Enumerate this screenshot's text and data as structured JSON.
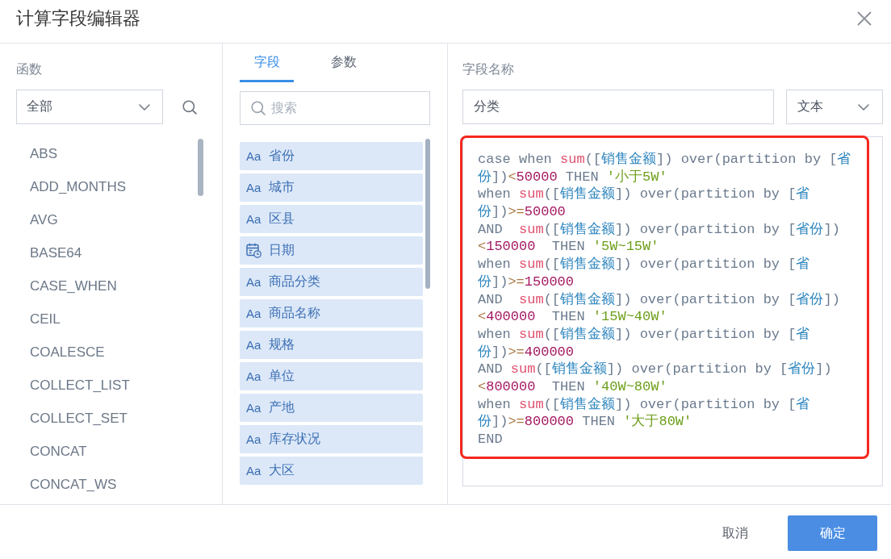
{
  "dialog": {
    "title": "计算字段编辑器"
  },
  "functions_panel": {
    "label": "函数",
    "category": "全部",
    "functions": [
      "ABS",
      "ADD_MONTHS",
      "AVG",
      "BASE64",
      "CASE_WHEN",
      "CEIL",
      "COALESCE",
      "COLLECT_LIST",
      "COLLECT_SET",
      "CONCAT",
      "CONCAT_WS"
    ]
  },
  "fields_panel": {
    "tabs": [
      {
        "label": "字段",
        "selected": true
      },
      {
        "label": "参数",
        "selected": false
      }
    ],
    "search": {
      "placeholder": "搜索"
    },
    "fields": [
      {
        "kind": "text",
        "type_label": "Aa",
        "label": "省份"
      },
      {
        "kind": "text",
        "type_label": "Aa",
        "label": "城市"
      },
      {
        "kind": "text",
        "type_label": "Aa",
        "label": "区县"
      },
      {
        "kind": "date",
        "label": "日期"
      },
      {
        "kind": "text",
        "type_label": "Aa",
        "label": "商品分类"
      },
      {
        "kind": "text",
        "type_label": "Aa",
        "label": "商品名称"
      },
      {
        "kind": "text",
        "type_label": "Aa",
        "label": "规格"
      },
      {
        "kind": "text",
        "type_label": "Aa",
        "label": "单位"
      },
      {
        "kind": "text",
        "type_label": "Aa",
        "label": "产地"
      },
      {
        "kind": "text",
        "type_label": "Aa",
        "label": "库存状况"
      },
      {
        "kind": "text",
        "type_label": "Aa",
        "label": "大区"
      }
    ]
  },
  "editor_panel": {
    "name_label": "字段名称",
    "name_value": "分类",
    "data_type": "文本",
    "highlighted": true,
    "code_lines": [
      [
        {
          "kind": "plain",
          "text": "case when "
        },
        {
          "kind": "func",
          "text": "sum"
        },
        {
          "kind": "plain",
          "text": "(["
        },
        {
          "kind": "field",
          "text": "销售金额"
        },
        {
          "kind": "plain",
          "text": "]) over(partition by ["
        },
        {
          "kind": "field",
          "text": "省"
        }
      ],
      [
        {
          "kind": "field",
          "text": "份"
        },
        {
          "kind": "plain",
          "text": "])"
        },
        {
          "kind": "op",
          "text": "<"
        },
        {
          "kind": "number",
          "text": "50000"
        },
        {
          "kind": "plain",
          "text": " THEN "
        },
        {
          "kind": "string",
          "text": "'小于5W'"
        }
      ],
      [
        {
          "kind": "plain",
          "text": "when "
        },
        {
          "kind": "func",
          "text": "sum"
        },
        {
          "kind": "plain",
          "text": "(["
        },
        {
          "kind": "field",
          "text": "销售金额"
        },
        {
          "kind": "plain",
          "text": "]) over(partition by ["
        },
        {
          "kind": "field",
          "text": "省"
        }
      ],
      [
        {
          "kind": "field",
          "text": "份"
        },
        {
          "kind": "plain",
          "text": "])"
        },
        {
          "kind": "op",
          "text": ">="
        },
        {
          "kind": "number",
          "text": "50000"
        }
      ],
      [
        {
          "kind": "plain",
          "text": "AND  "
        },
        {
          "kind": "func",
          "text": "sum"
        },
        {
          "kind": "plain",
          "text": "(["
        },
        {
          "kind": "field",
          "text": "销售金额"
        },
        {
          "kind": "plain",
          "text": "]) over(partition by ["
        },
        {
          "kind": "field",
          "text": "省份"
        },
        {
          "kind": "plain",
          "text": "])"
        }
      ],
      [
        {
          "kind": "op",
          "text": "<"
        },
        {
          "kind": "number",
          "text": "150000"
        },
        {
          "kind": "plain",
          "text": "  THEN "
        },
        {
          "kind": "string",
          "text": "'5W~15W'"
        }
      ],
      [
        {
          "kind": "plain",
          "text": "when "
        },
        {
          "kind": "func",
          "text": "sum"
        },
        {
          "kind": "plain",
          "text": "(["
        },
        {
          "kind": "field",
          "text": "销售金额"
        },
        {
          "kind": "plain",
          "text": "]) over(partition by ["
        },
        {
          "kind": "field",
          "text": "省"
        }
      ],
      [
        {
          "kind": "field",
          "text": "份"
        },
        {
          "kind": "plain",
          "text": "])"
        },
        {
          "kind": "op",
          "text": ">="
        },
        {
          "kind": "number",
          "text": "150000"
        }
      ],
      [
        {
          "kind": "plain",
          "text": "AND  "
        },
        {
          "kind": "func",
          "text": "sum"
        },
        {
          "kind": "plain",
          "text": "(["
        },
        {
          "kind": "field",
          "text": "销售金额"
        },
        {
          "kind": "plain",
          "text": "]) over(partition by ["
        },
        {
          "kind": "field",
          "text": "省份"
        },
        {
          "kind": "plain",
          "text": "])"
        }
      ],
      [
        {
          "kind": "op",
          "text": "<"
        },
        {
          "kind": "number",
          "text": "400000"
        },
        {
          "kind": "plain",
          "text": "  THEN "
        },
        {
          "kind": "string",
          "text": "'15W~40W'"
        }
      ],
      [
        {
          "kind": "plain",
          "text": "when "
        },
        {
          "kind": "func",
          "text": "sum"
        },
        {
          "kind": "plain",
          "text": "(["
        },
        {
          "kind": "field",
          "text": "销售金额"
        },
        {
          "kind": "plain",
          "text": "]) over(partition by ["
        },
        {
          "kind": "field",
          "text": "省"
        }
      ],
      [
        {
          "kind": "field",
          "text": "份"
        },
        {
          "kind": "plain",
          "text": "])"
        },
        {
          "kind": "op",
          "text": ">="
        },
        {
          "kind": "number",
          "text": "400000"
        }
      ],
      [
        {
          "kind": "plain",
          "text": "AND "
        },
        {
          "kind": "func",
          "text": "sum"
        },
        {
          "kind": "plain",
          "text": "(["
        },
        {
          "kind": "field",
          "text": "销售金额"
        },
        {
          "kind": "plain",
          "text": "]) over(partition by ["
        },
        {
          "kind": "field",
          "text": "省份"
        },
        {
          "kind": "plain",
          "text": "])"
        }
      ],
      [
        {
          "kind": "op",
          "text": "<"
        },
        {
          "kind": "number",
          "text": "800000"
        },
        {
          "kind": "plain",
          "text": "  THEN "
        },
        {
          "kind": "string",
          "text": "'40W~80W'"
        }
      ],
      [
        {
          "kind": "plain",
          "text": "when "
        },
        {
          "kind": "func",
          "text": "sum"
        },
        {
          "kind": "plain",
          "text": "(["
        },
        {
          "kind": "field",
          "text": "销售金额"
        },
        {
          "kind": "plain",
          "text": "]) over(partition by ["
        },
        {
          "kind": "field",
          "text": "省"
        }
      ],
      [
        {
          "kind": "field",
          "text": "份"
        },
        {
          "kind": "plain",
          "text": "])"
        },
        {
          "kind": "op",
          "text": ">="
        },
        {
          "kind": "number",
          "text": "800000"
        },
        {
          "kind": "plain",
          "text": " THEN "
        },
        {
          "kind": "string",
          "text": "'大于80W'"
        }
      ],
      [
        {
          "kind": "plain",
          "text": "END"
        }
      ]
    ]
  },
  "footer": {
    "buttons": [
      {
        "kind": "secondary",
        "label": "取消"
      },
      {
        "kind": "primary",
        "label": "确定"
      }
    ]
  }
}
